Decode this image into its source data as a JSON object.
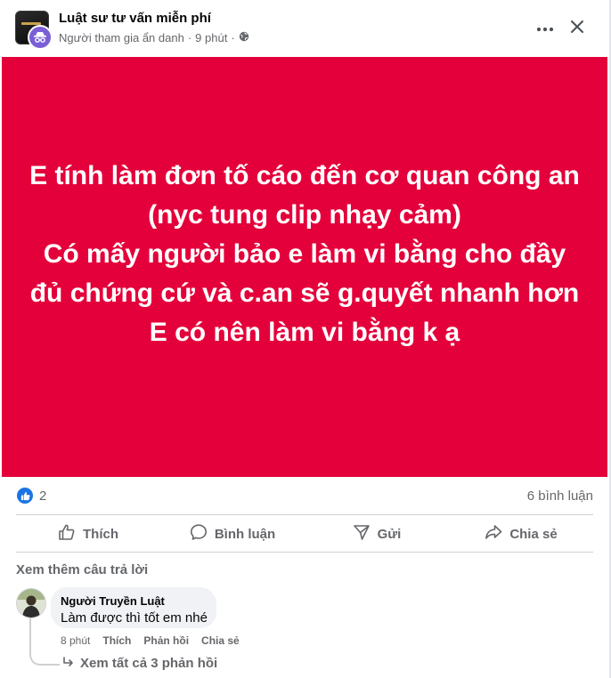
{
  "post": {
    "page_name": "Luật sư tư vấn miễn phí",
    "author": "Người tham gia ẩn danh",
    "separator": "·",
    "time": "9 phút",
    "body": "E tính làm đơn tố cáo đến cơ quan công an\n(nyc tung clip nhạy cảm)\nCó mấy người bảo e làm vi bằng cho đầy\nđủ chứng cứ và c.an sẽ g.quyết nhanh hơn\nE có nên làm vi bằng k ạ",
    "background_color": "#e4003a",
    "reaction_count": "2",
    "comment_count": "6 bình luận"
  },
  "actions": {
    "like": "Thích",
    "comment": "Bình luận",
    "send": "Gửi",
    "share": "Chia sẻ"
  },
  "comments_section": {
    "see_more": "Xem thêm câu trả lời",
    "comment": {
      "author": "Người Truyền Luật",
      "text": "Làm được thì tốt em nhé",
      "time": "8 phút",
      "like": "Thích",
      "reply": "Phản hồi",
      "share": "Chia sẻ"
    },
    "view_replies": "Xem tất cả 3 phản hồi"
  },
  "icons": {
    "more": "more-horizontal-icon",
    "close": "close-icon",
    "privacy": "globe-icon",
    "anonymous": "anonymous-icon",
    "reaction": "like-reaction-icon",
    "reply_arrow": "reply-arrow-icon"
  },
  "colors": {
    "accent": "#1b74e4",
    "muted_text": "#65676b"
  }
}
